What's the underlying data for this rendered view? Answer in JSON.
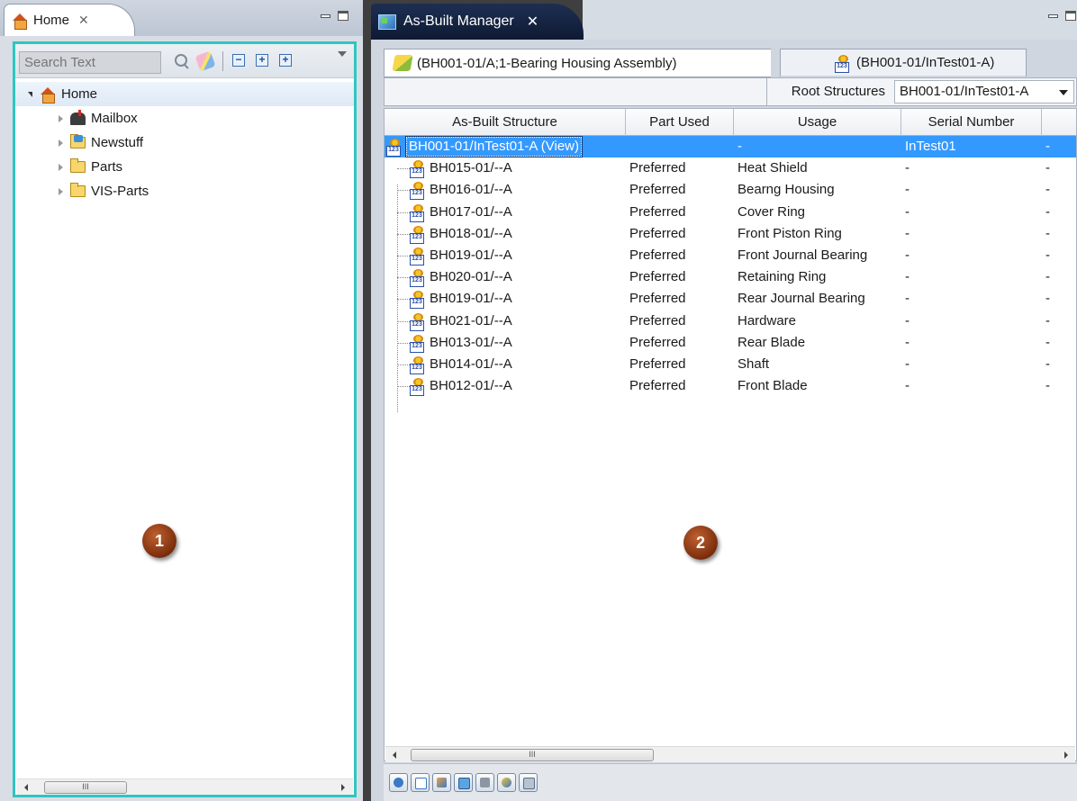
{
  "left_view": {
    "tab_title": "Home",
    "tab_close": "✕",
    "search_placeholder": "Search Text",
    "tree": {
      "root": "Home",
      "children": [
        {
          "label": "Mailbox"
        },
        {
          "label": "Newstuff"
        },
        {
          "label": "Parts"
        },
        {
          "label": "VIS-Parts"
        }
      ]
    },
    "scroll_thumb": "III"
  },
  "right_view": {
    "tab_title": "As-Built Manager",
    "tab_close": "✕",
    "editor_tabs": [
      {
        "label": "(BH001-01/A;1-Bearing Housing Assembly)"
      },
      {
        "label": "(BH001-01/InTest01-A)"
      }
    ],
    "root_structures_label": "Root Structures",
    "root_structures_value": "BH001-01/InTest01-A",
    "columns": [
      "As-Built Structure",
      "Part Used",
      "Usage",
      "Serial Number"
    ],
    "root_row": {
      "structure": "BH001-01/InTest01-A (View)",
      "part_used": "",
      "usage": "-",
      "serial": "InTest01",
      "last": "-"
    },
    "rows": [
      {
        "structure": "BH015-01/--A",
        "part_used": "Preferred",
        "usage": "Heat Shield",
        "serial": "-",
        "last": "-"
      },
      {
        "structure": "BH016-01/--A",
        "part_used": "Preferred",
        "usage": "Bearng Housing",
        "serial": "-",
        "last": "-"
      },
      {
        "structure": "BH017-01/--A",
        "part_used": "Preferred",
        "usage": "Cover Ring",
        "serial": "-",
        "last": "-"
      },
      {
        "structure": "BH018-01/--A",
        "part_used": "Preferred",
        "usage": "Front Piston Ring",
        "serial": "-",
        "last": "-"
      },
      {
        "structure": "BH019-01/--A",
        "part_used": "Preferred",
        "usage": "Front Journal Bearing",
        "serial": "-",
        "last": "-"
      },
      {
        "structure": "BH020-01/--A",
        "part_used": "Preferred",
        "usage": "Retaining Ring",
        "serial": "-",
        "last": "-"
      },
      {
        "structure": "BH019-01/--A",
        "part_used": "Preferred",
        "usage": "Rear Journal Bearing",
        "serial": "-",
        "last": "-"
      },
      {
        "structure": "BH021-01/--A",
        "part_used": "Preferred",
        "usage": "Hardware",
        "serial": "-",
        "last": "-"
      },
      {
        "structure": "BH013-01/--A",
        "part_used": "Preferred",
        "usage": "Rear Blade",
        "serial": "-",
        "last": "-"
      },
      {
        "structure": "BH014-01/--A",
        "part_used": "Preferred",
        "usage": "Shaft",
        "serial": "-",
        "last": "-"
      },
      {
        "structure": "BH012-01/--A",
        "part_used": "Preferred",
        "usage": "Front Blade",
        "serial": "-",
        "last": "-"
      }
    ],
    "scroll_thumb": "III"
  },
  "callouts": {
    "one": "1",
    "two": "2"
  },
  "colors": {
    "highlight_border": "#2fc6c0",
    "selection": "#3399ff",
    "callout": "#7a2d0c"
  }
}
